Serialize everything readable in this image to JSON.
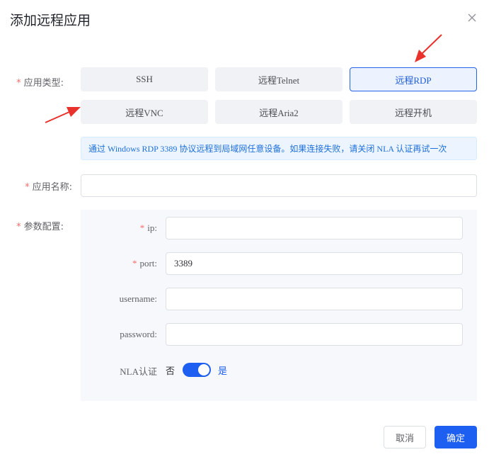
{
  "dialog": {
    "title": "添加远程应用"
  },
  "form": {
    "type_label": "应用类型:",
    "types": [
      "SSH",
      "远程Telnet",
      "远程RDP",
      "远程VNC",
      "远程Aria2",
      "远程开机"
    ],
    "selected_type": "远程RDP",
    "tip": "通过 Windows RDP 3389 协议远程到局域网任意设备。如果连接失败，请关闭 NLA 认证再试一次",
    "name_label": "应用名称:",
    "name_value": "",
    "params_label": "参数配置:",
    "required_mark": "*",
    "params": {
      "ip_label": "ip:",
      "ip_value": "",
      "port_label": "port:",
      "port_value": "3389",
      "username_label": "username:",
      "username_value": "",
      "password_label": "password:",
      "password_value": "",
      "nla_label": "NLA认证",
      "nla_off_text": "否",
      "nla_on_text": "是",
      "nla_enabled": true
    }
  },
  "footer": {
    "cancel_label": "取消",
    "ok_label": "确定"
  },
  "colors": {
    "primary": "#1d5ff0",
    "required": "#f56c6c",
    "annotation_arrow": "#e8322b"
  }
}
